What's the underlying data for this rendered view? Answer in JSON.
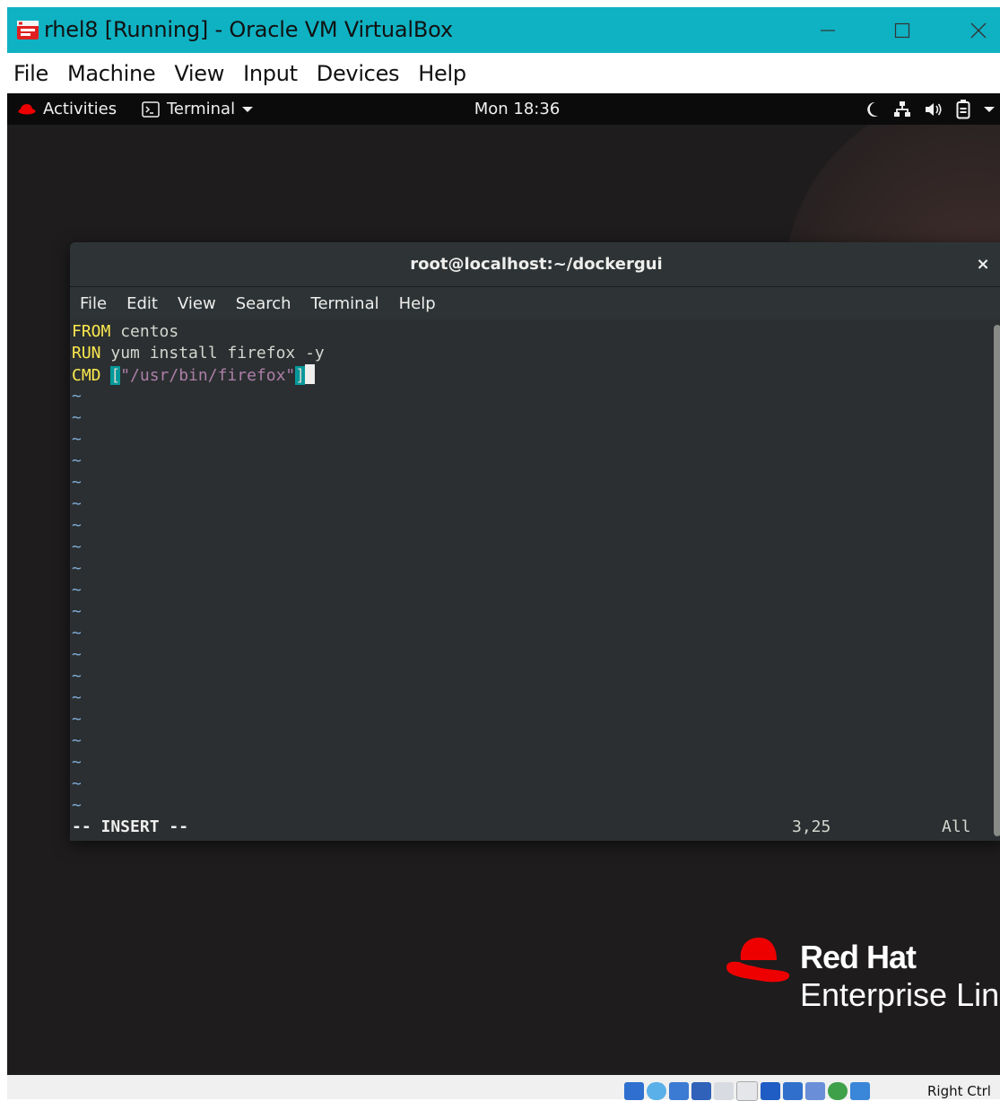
{
  "window": {
    "title": "rhel8 [Running] - Oracle VM VirtualBox",
    "app_icon": "virtualbox-icon",
    "controls": [
      "minimize-icon",
      "maximize-icon",
      "close-icon"
    ]
  },
  "vbox_menu": {
    "items": [
      "File",
      "Machine",
      "View",
      "Input",
      "Devices",
      "Help"
    ]
  },
  "gnome_bar": {
    "activities_label": "Activities",
    "app_label": "Terminal",
    "clock": "Mon 18:36",
    "tray_icons": [
      "night-light-icon",
      "network-icon",
      "volume-icon",
      "battery-icon",
      "chevron-down-icon"
    ]
  },
  "terminal": {
    "title": "root@localhost:~/dockergui",
    "close_label": "×",
    "menu": [
      "File",
      "Edit",
      "View",
      "Search",
      "Terminal",
      "Help"
    ],
    "lines": [
      {
        "keyword": "FROM",
        "rest": " centos"
      },
      {
        "keyword": "RUN",
        "rest": " yum install firefox -y"
      },
      {
        "keyword": "CMD",
        "rest": " ",
        "bracket_open": "[",
        "string": "\"/usr/bin/firefox\"",
        "bracket_close": "]"
      }
    ],
    "tilde_count": 20,
    "tilde": "~",
    "mode": "-- INSERT --",
    "cursor_pos": "3,25",
    "scroll_pos": "All"
  },
  "brand": {
    "line1": "Red Hat",
    "line2": "Enterprise Linux"
  },
  "vbox_status": {
    "host_key": "Right Ctrl",
    "icons": [
      "hard-disk-icon",
      "optical-drive-icon",
      "audio-icon",
      "network-adapter-icon",
      "usb-icon",
      "shared-folders-icon",
      "display-icon",
      "video-capture-icon",
      "mouse-integration-icon",
      "guest-additions-icon",
      "keyboard-capture-icon"
    ]
  },
  "colors": {
    "titlebar": "#0fb2c3",
    "keyword": "#fce94f",
    "string": "#ad7fa8",
    "bracket_highlight": "#06989a",
    "tilde": "#7faad4",
    "redhat_red": "#ee0000"
  }
}
